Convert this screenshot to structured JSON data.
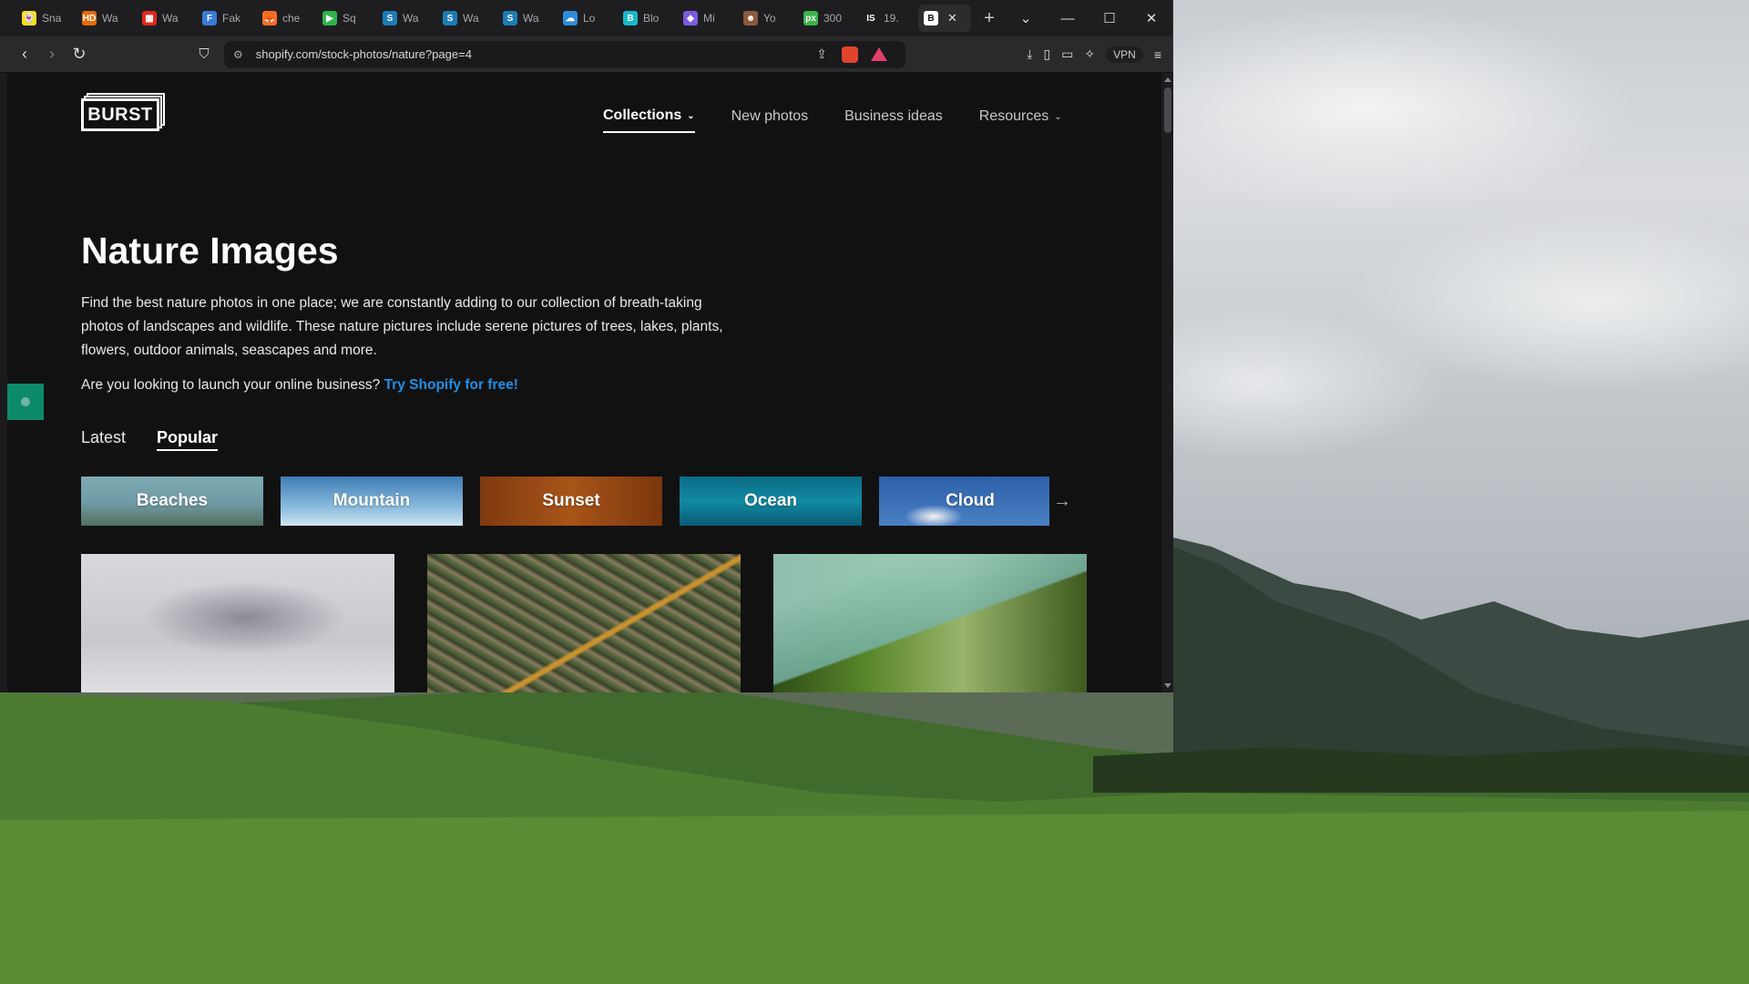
{
  "browser": {
    "tabs": [
      {
        "label": "Sna",
        "icon": "snapchat-icon",
        "color": "#f7e01b",
        "glyph": "👻"
      },
      {
        "label": "Wa",
        "icon": "hd-icon",
        "color": "#e36a0a",
        "glyph": "HD"
      },
      {
        "label": "Wa",
        "icon": "grid-icon",
        "color": "#e2261b",
        "glyph": "▦"
      },
      {
        "label": "Fak",
        "icon": "doc-icon",
        "color": "#3a7bd5",
        "glyph": "F"
      },
      {
        "label": "che",
        "icon": "gitlab-icon",
        "color": "#fc6d26",
        "glyph": "🦊"
      },
      {
        "label": "Sq",
        "icon": "play-icon",
        "color": "#2fb24b",
        "glyph": "▶"
      },
      {
        "label": "Wa",
        "icon": "s-icon",
        "color": "#1e7bb5",
        "glyph": "S"
      },
      {
        "label": "Wa",
        "icon": "s-icon",
        "color": "#1e7bb5",
        "glyph": "S"
      },
      {
        "label": "Wa",
        "icon": "s-icon",
        "color": "#1e7bb5",
        "glyph": "S"
      },
      {
        "label": "Lo",
        "icon": "cloud-icon",
        "color": "#2f8cd8",
        "glyph": "☁"
      },
      {
        "label": "Blo",
        "icon": "b-icon",
        "color": "#18b7c9",
        "glyph": "B"
      },
      {
        "label": "Mi",
        "icon": "copilot-icon",
        "color": "#7a5be0",
        "glyph": "◆"
      },
      {
        "label": "Yo",
        "icon": "avatar-icon",
        "color": "#8a5a3c",
        "glyph": "☻"
      },
      {
        "label": "300",
        "icon": "px-icon",
        "color": "#3bb34a",
        "glyph": "px"
      },
      {
        "label": "19.",
        "icon": "is-icon",
        "color": "#1e1e20",
        "glyph": "IS"
      }
    ],
    "active_tab": {
      "label": "",
      "glyph": "B",
      "close": "✕"
    },
    "new_tab": "+",
    "window_controls": {
      "tab_list": "⌄",
      "minimize": "—",
      "maximize": "☐",
      "close": "✕"
    },
    "url": "shopify.com/stock-photos/nature?page=4",
    "toolbar": {
      "back": "‹",
      "forward": "›",
      "reload": "↻",
      "bookmark": "⛉",
      "download": "⤓",
      "sidebar": "▯",
      "wallet": "▭",
      "ai": "✧",
      "vpn": "VPN",
      "menu": "≡",
      "share": "⇪"
    }
  },
  "site": {
    "logo": "BURST",
    "nav": [
      {
        "label": "Collections",
        "chevron": "⌄",
        "active": true
      },
      {
        "label": "New photos",
        "chevron": "",
        "active": false
      },
      {
        "label": "Business ideas",
        "chevron": "",
        "active": false
      },
      {
        "label": "Resources",
        "chevron": "⌄",
        "active": false
      }
    ],
    "title": "Nature Images",
    "description": "Find the best nature photos in one place; we are constantly adding to our collection of breath-taking photos of landscapes and wildlife. These nature pictures include serene pictures of trees, lakes, plants, flowers, outdoor animals, seascapes and more.",
    "cta_text": "Are you looking to launch your online business?",
    "cta_link": "Try Shopify for free!",
    "sort_tabs": [
      "Latest",
      "Popular"
    ],
    "active_sort": "Popular",
    "categories": [
      "Beaches",
      "Mountain",
      "Sunset",
      "Ocean",
      "Cloud"
    ],
    "next_arrow": "→"
  },
  "colors": {
    "link": "#1f8fe5",
    "page_bg": "#111112",
    "badge": "#0d8a67"
  }
}
